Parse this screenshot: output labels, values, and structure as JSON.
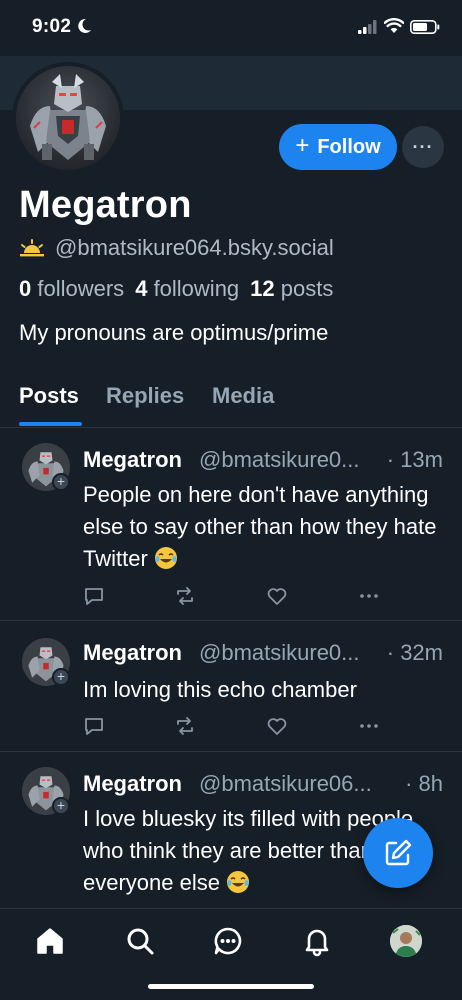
{
  "status_bar": {
    "time": "9:02"
  },
  "profile": {
    "display_name": "Megatron",
    "handle": "@bmatsikure064.bsky.social",
    "followers_count": "0",
    "followers_label": "followers",
    "following_count": "4",
    "following_label": "following",
    "posts_count": "12",
    "posts_label": "posts",
    "bio": "My pronouns are optimus/prime",
    "follow_label": "Follow",
    "more_label": "···"
  },
  "tabs": [
    {
      "label": "Posts",
      "active": true
    },
    {
      "label": "Replies",
      "active": false
    },
    {
      "label": "Media",
      "active": false
    }
  ],
  "posts": [
    {
      "author": "Megatron",
      "handle": "@bmatsikure0...",
      "time": "· 13m",
      "text": "People on here don't have anything else to say other than how they hate Twitter"
    },
    {
      "author": "Megatron",
      "handle": "@bmatsikure0...",
      "time": "· 32m",
      "text": "Im loving this echo chamber"
    },
    {
      "author": "Megatron",
      "handle": "@bmatsikure06...",
      "time": "· 8h",
      "text": "I love bluesky its filled with people who think they are better than everyone else"
    }
  ],
  "icons": {
    "status": [
      "moon-icon",
      "signal-icon",
      "wifi-icon",
      "battery-icon"
    ],
    "post_actions": [
      "reply-icon",
      "repost-icon",
      "like-icon",
      "more-icon"
    ],
    "compose": "compose-icon",
    "nav": [
      "home-icon",
      "search-icon",
      "chat-icon",
      "notifications-icon",
      "profile-avatar"
    ]
  },
  "colors": {
    "background": "#161e27",
    "accent": "#1d83ef",
    "muted_text": "#97a6b4",
    "divider": "#2a3540"
  }
}
